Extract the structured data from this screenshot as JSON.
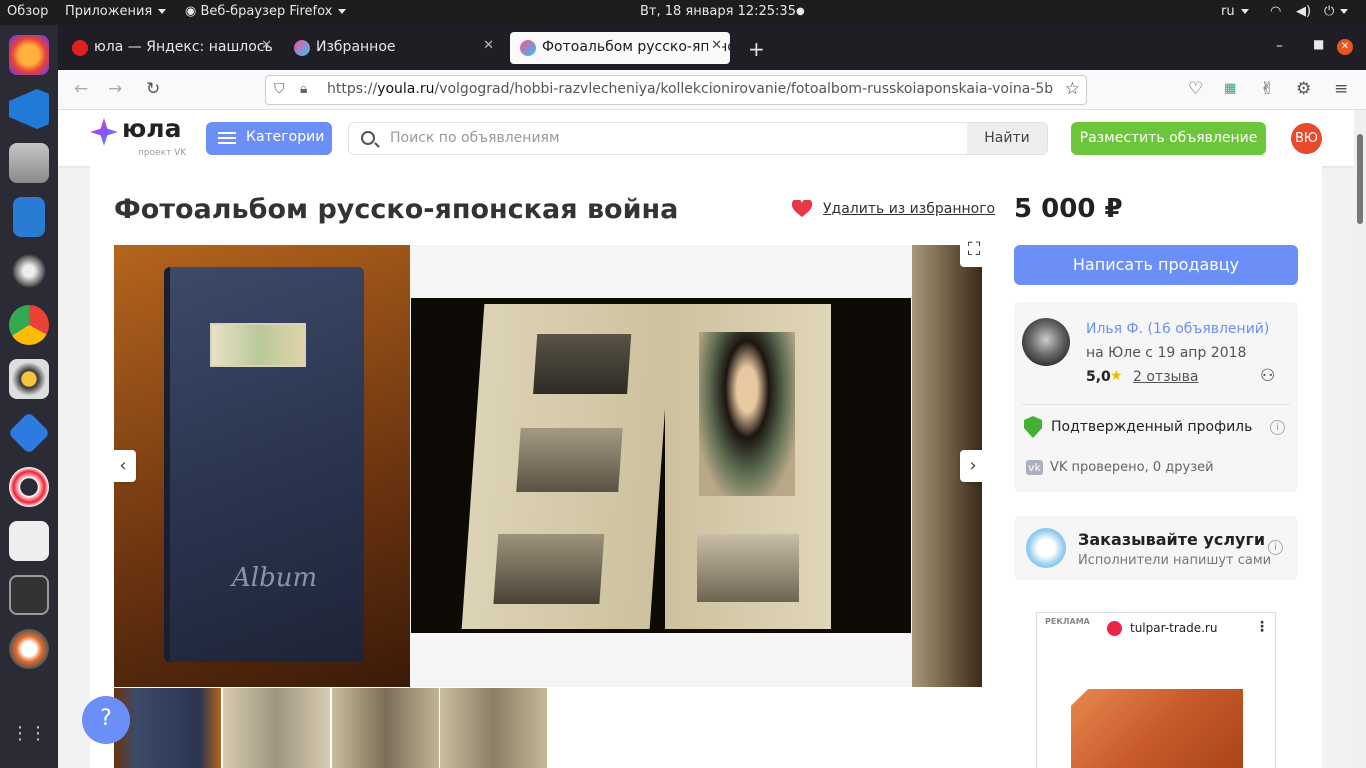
{
  "topbar": {
    "overview": "Обзор",
    "apps": "Приложения",
    "browser": "Веб-браузер Firefox",
    "clock": "Вт, 18 января  12:25:35",
    "lang": "ru"
  },
  "tabs": [
    {
      "label": "юла — Яндекс: нашлось"
    },
    {
      "label": "Избранное"
    },
    {
      "label": "Фотоальбом русско-японская война"
    }
  ],
  "nav": {
    "url_prefix": "https://",
    "url_domain": "youla.ru",
    "url_path": "/volgograd/hobbi-razvlecheniya/kollekcionirovanie/fotoalbom-russkoiaponskaia-voina-5b"
  },
  "header": {
    "logo": "юла",
    "logo_sub": "проект VK",
    "categories": "Категории",
    "search_placeholder": "Поиск по объявлениям",
    "find": "Найти",
    "post_ad": "Разместить объявление",
    "avatar": "ВЮ"
  },
  "listing": {
    "title": "Фотоальбом русско-японская война",
    "remove_favorite": "Удалить из избранного",
    "price": "5 000 ₽",
    "album_label": "Album"
  },
  "sidebar": {
    "write_seller": "Написать продавцу",
    "seller_name": "Илья Ф. (16 объявлений)",
    "since": "на Юле с 19 апр 2018",
    "rating": "5,0",
    "reviews": "2 отзыва",
    "verified": "Подтвержденный профиль",
    "vk": "VK проверено, 0 друзей"
  },
  "services": {
    "title": "Заказывайте услуги",
    "subtitle": "Исполнители напишут сами"
  },
  "ad": {
    "label": "РЕКЛАМА",
    "domain": "tulpar-trade.ru"
  },
  "colors": {
    "accent": "#6c8ff7",
    "green": "#6cc53b",
    "heart": "#e53945",
    "link": "#6c8ff7"
  }
}
